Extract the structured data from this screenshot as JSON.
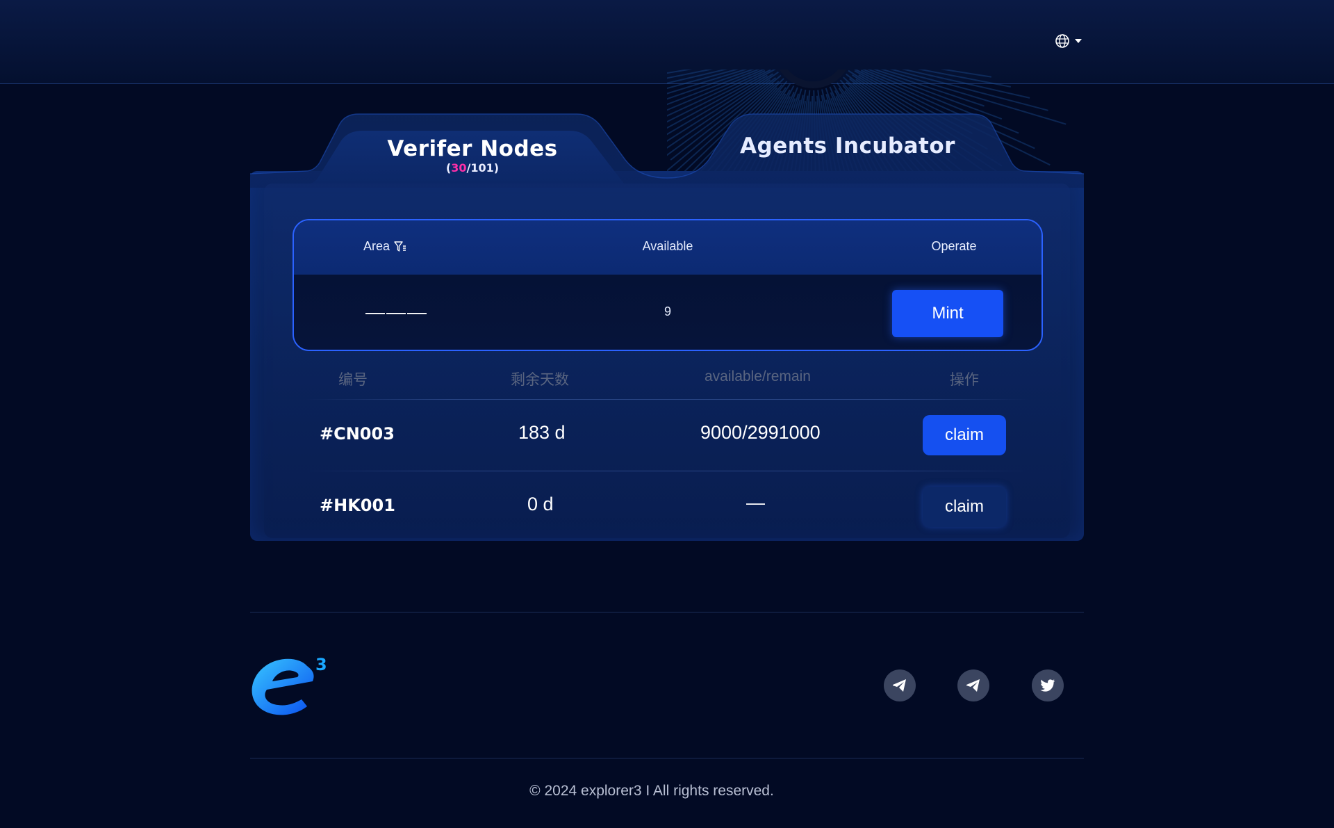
{
  "header": {
    "language_icon": "globe-icon",
    "dropdown_icon": "caret-down-icon"
  },
  "tabs": {
    "verifer": {
      "title": "Verifer Nodes",
      "count_open": "(",
      "count_highlight": "30",
      "count_rest": "/101)"
    },
    "agents": {
      "title": "Agents Incubator"
    }
  },
  "mint_table": {
    "headers": {
      "area": "Area",
      "available": "Available",
      "operate": "Operate"
    },
    "filter_icon": "filter-icon",
    "row": {
      "area": "———",
      "available": "9",
      "button": "Mint"
    }
  },
  "claim_table": {
    "headers": {
      "id": "编号",
      "days": "剩余天数",
      "available_remain": "available/remain",
      "operate": "操作"
    },
    "rows": [
      {
        "id": "#CN003",
        "days": "183 d",
        "available_remain": "9000/2991000",
        "button": "claim",
        "state": "active"
      },
      {
        "id": "#HK001",
        "days": "0 d",
        "available_remain": "—",
        "button": "claim",
        "state": "disabled"
      }
    ]
  },
  "footer": {
    "logo_letter": "e",
    "logo_superscript": "3",
    "social": [
      "telegram-icon",
      "telegram-icon",
      "twitter-icon"
    ],
    "copyright": "© 2024 explorer3 I All rights reserved."
  },
  "colors": {
    "accent": "#1650f5",
    "highlight": "#ff2fa8",
    "background": "#020a24"
  }
}
